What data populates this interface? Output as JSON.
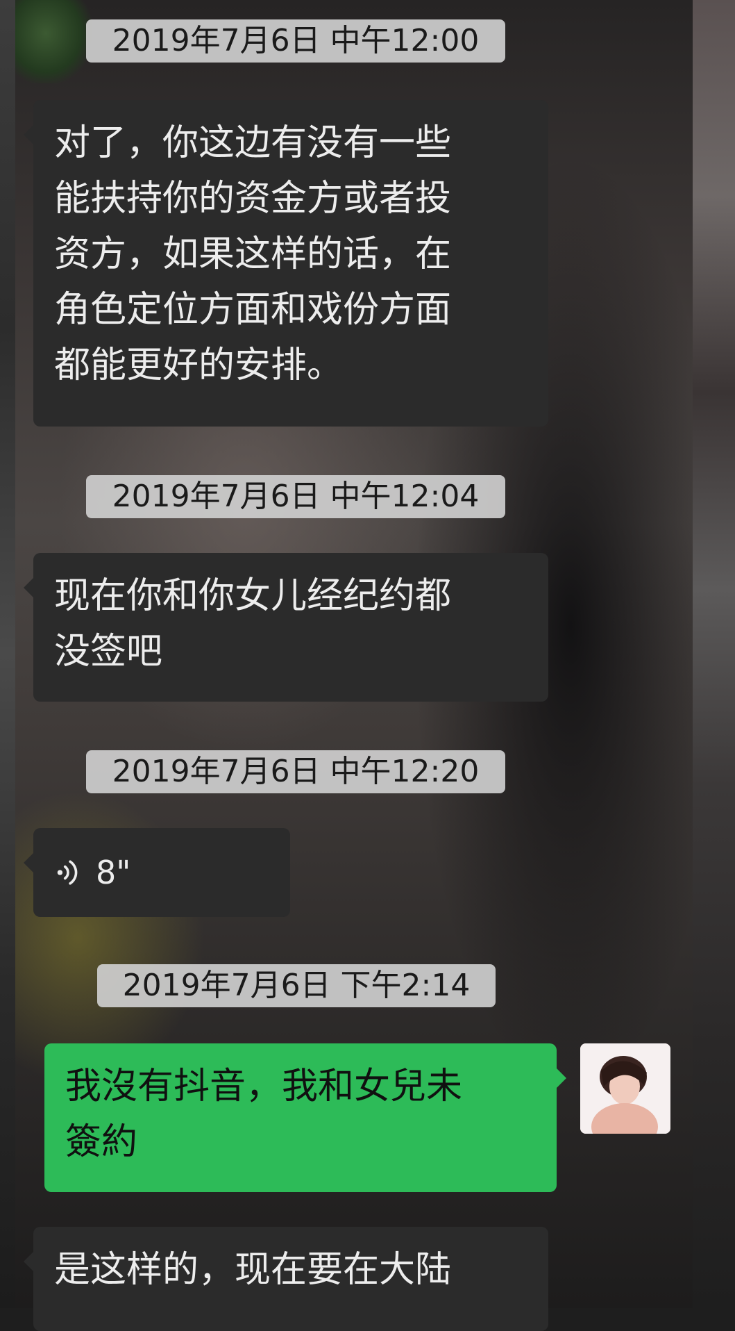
{
  "chat": {
    "messages": [
      {
        "type": "timestamp",
        "text": "2019年7月6日 中午12:00"
      },
      {
        "type": "incoming",
        "lines": [
          "对了，你这边有没有一些",
          "能扶持你的资金方或者投",
          "资方，如果这样的话，在",
          "角色定位方面和戏份方面",
          "都能更好的安排。"
        ]
      },
      {
        "type": "timestamp",
        "text": "2019年7月6日 中午12:04"
      },
      {
        "type": "incoming",
        "lines": [
          "现在你和你女儿经纪约都",
          "没签吧"
        ]
      },
      {
        "type": "timestamp",
        "text": "2019年7月6日 中午12:20"
      },
      {
        "type": "voice",
        "duration": "8\"",
        "icon": "voice-wave-icon"
      },
      {
        "type": "timestamp",
        "text": "2019年7月6日 下午2:14"
      },
      {
        "type": "outgoing",
        "lines": [
          "我沒有抖音，我和女兒未",
          "簽約"
        ],
        "avatar": "user-avatar"
      },
      {
        "type": "incoming",
        "lines": [
          "是这样的，现在要在大陆"
        ]
      }
    ]
  },
  "colors": {
    "incoming_bubble": "#2b2b2b",
    "outgoing_bubble": "#2dbb58",
    "timestamp_bg": "#cecece"
  }
}
